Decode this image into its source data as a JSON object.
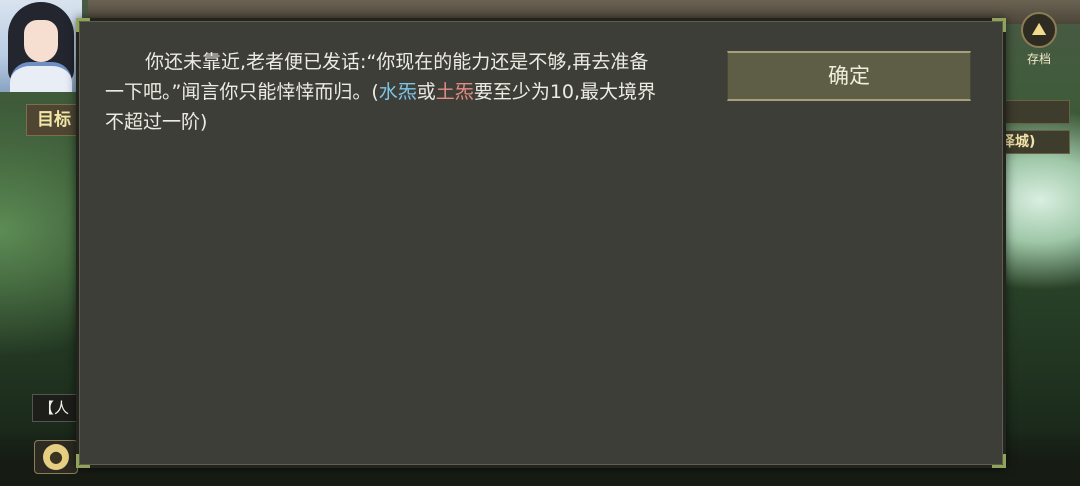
{
  "hud": {
    "target_label": "目标",
    "save_label": "存档",
    "right_tag_text": "泽城)",
    "log_prefix": "【人",
    "save_icon": "mountain-emblem-icon",
    "avatar_icon": "person-icon"
  },
  "dialog": {
    "text_part1": "你还未靠近,老者便已发话:“你现在的能力还是不够,再去准备一下吧。”闻言你只能悻悻而归。(",
    "water_attr": "水炁",
    "or_word": "或",
    "earth_attr": "土炁",
    "text_part2": "要至少为10,最大境界不超过一阶)",
    "confirm_label": "确定"
  },
  "colors": {
    "water": "#7fc4e6",
    "earth": "#e38b84",
    "dialog_bg": "#3e3e38",
    "accent_corner": "#8fa35a"
  }
}
